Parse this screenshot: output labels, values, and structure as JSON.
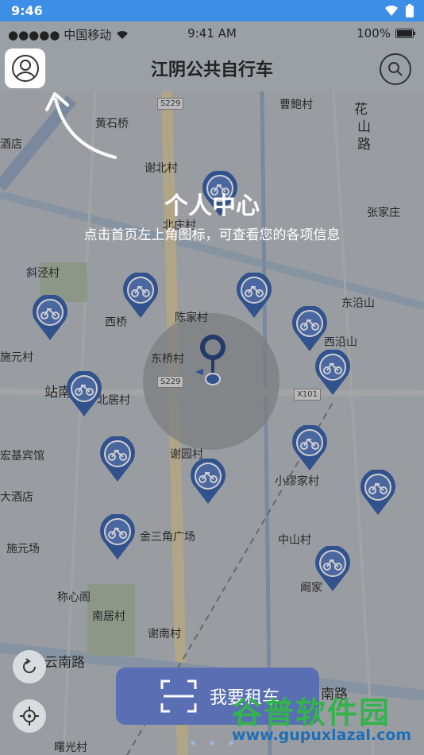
{
  "system_bar": {
    "time": "9:46"
  },
  "ios_status": {
    "carrier": "●●●●● 中国移动",
    "time": "9:41 AM",
    "battery": "100%"
  },
  "header": {
    "title": "江阴公共自行车",
    "profile_icon": "person-circle-icon",
    "search_icon": "search-icon"
  },
  "overlay": {
    "title": "个人中心",
    "subtitle": "点击首页左上角图标，可查看您的各项信息"
  },
  "map": {
    "labels": [
      {
        "text": "黄石桥"
      },
      {
        "text": "曹鲍村"
      },
      {
        "text": "花"
      },
      {
        "text": "山"
      },
      {
        "text": "路"
      },
      {
        "text": "酒店"
      },
      {
        "text": "谢北村"
      },
      {
        "text": "北庄村"
      },
      {
        "text": "张家庄"
      },
      {
        "text": "斜泾村"
      },
      {
        "text": "西桥"
      },
      {
        "text": "陈家村"
      },
      {
        "text": "东沿山"
      },
      {
        "text": "西沿山"
      },
      {
        "text": "施元村"
      },
      {
        "text": "东桥村"
      },
      {
        "text": "站南"
      },
      {
        "text": "北居村"
      },
      {
        "text": "宏基宾馆"
      },
      {
        "text": "谢园村"
      },
      {
        "text": "小缪家村"
      },
      {
        "text": "大酒店"
      },
      {
        "text": "施元场"
      },
      {
        "text": "金三角广场"
      },
      {
        "text": "中山村"
      },
      {
        "text": "称心阁"
      },
      {
        "text": "阚家"
      },
      {
        "text": "南居村"
      },
      {
        "text": "谢南村"
      },
      {
        "text": "云南路"
      },
      {
        "text": "南路"
      },
      {
        "text": "曙光村"
      }
    ],
    "road_tags": [
      "S229",
      "S229",
      "X101"
    ]
  },
  "controls": {
    "refresh_icon": "refresh-icon",
    "locate_icon": "crosshair-icon"
  },
  "rent_button": {
    "label": "我要租车",
    "icon": "scan-icon"
  },
  "watermark": {
    "brand": "谷普软件园",
    "url": "www.gupuxlazal.com"
  },
  "colors": {
    "status_bar": "#3d8ee6",
    "pin": "#2f5aa8",
    "button": "#5a6fb3",
    "watermark_green": "#34b34c"
  }
}
